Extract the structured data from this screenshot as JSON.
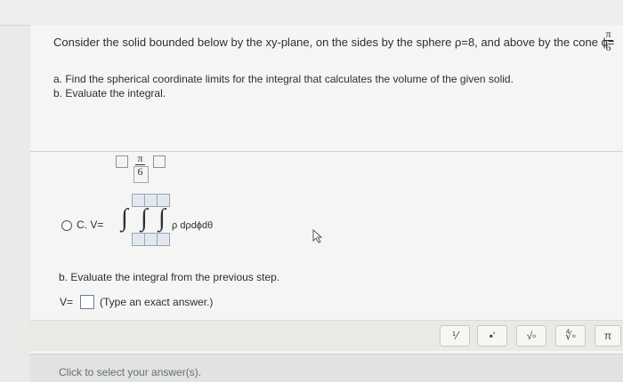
{
  "question": {
    "intro": "Consider the solid bounded below by the xy-plane, on the sides by the sphere ρ=8, and above by the cone ϕ=",
    "cone_num": "π",
    "cone_den": "6",
    "part_a": "a. Find the spherical coordinate limits for the integral that calculates the volume of the given solid.",
    "part_b": "b. Evaluate the integral."
  },
  "option_c": {
    "label": "C. V=",
    "upper_limit_num": "π",
    "upper_limit_den": "6",
    "integral_sign": "∫",
    "integrand": "ρ dρdϕdθ"
  },
  "step_b": {
    "prompt": "b. Evaluate the integral from the previous step.",
    "v_label": "V=",
    "hint": "(Type an exact answer.)"
  },
  "toolbar": {
    "fraction": "⅟",
    "superscript": "▪'",
    "sqrt": "√▫",
    "nthroot": "∜▫",
    "pi": "π"
  },
  "footer": {
    "text": "Click to select your answer(s)."
  }
}
